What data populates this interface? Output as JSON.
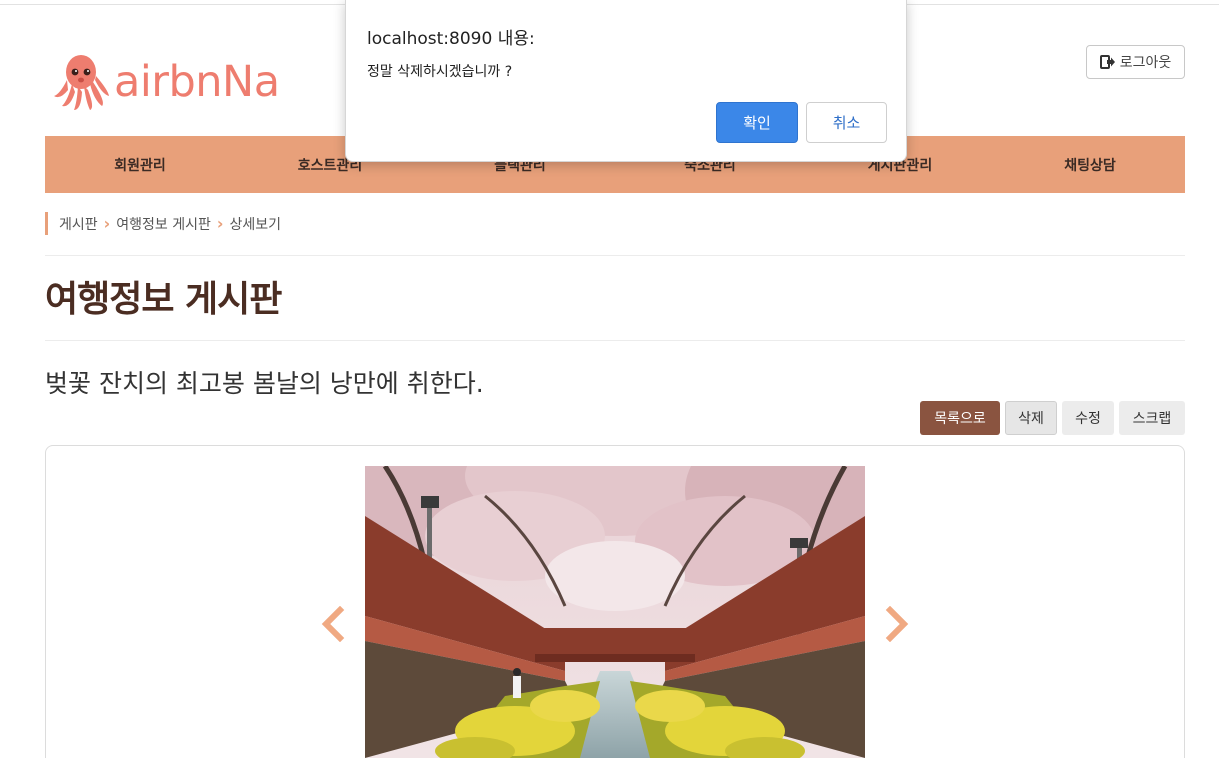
{
  "header": {
    "logo_text": "airbnNa",
    "logout_label": "로그아웃"
  },
  "nav": {
    "items": [
      {
        "label": "회원관리"
      },
      {
        "label": "호스트관리"
      },
      {
        "label": "블랙관리"
      },
      {
        "label": "숙소관리"
      },
      {
        "label": "게시판관리"
      },
      {
        "label": "채팅상담"
      }
    ]
  },
  "breadcrumb": {
    "items": [
      "게시판",
      "여행정보 게시판",
      "상세보기"
    ]
  },
  "page": {
    "title": "여행정보 게시판"
  },
  "post": {
    "title": "벚꽃 잔치의 최고봉 봄날의 낭만에 취한다.",
    "actions": {
      "list": "목록으로",
      "delete": "삭제",
      "edit": "수정",
      "scrap": "스크랩"
    }
  },
  "dialog": {
    "title": "localhost:8090 내용:",
    "message": "정말 삭제하시겠습니까 ?",
    "ok": "확인",
    "cancel": "취소"
  },
  "colors": {
    "accent": "#e8a07a",
    "title_brown": "#4b2d22",
    "list_button": "#8a5440",
    "logo": "#ee7d6f",
    "dialog_ok": "#3b87e8"
  },
  "icons": {
    "logout": "logout-icon",
    "logo": "octopus-logo-icon",
    "prev": "chevron-left-icon",
    "next": "chevron-right-icon"
  }
}
